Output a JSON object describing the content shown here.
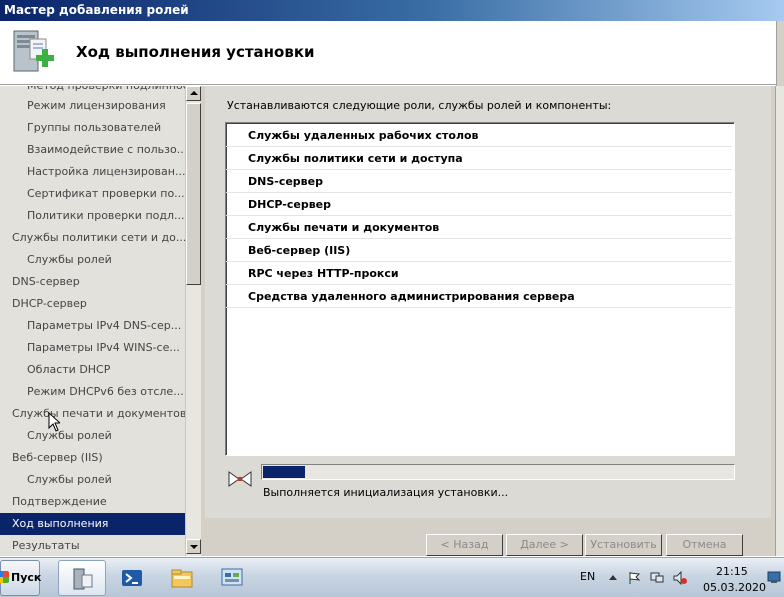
{
  "window": {
    "title": "Мастер добавления ролей"
  },
  "header": {
    "title": "Ход выполнения установки",
    "icon": "server-roles-add-icon"
  },
  "nav": {
    "items": [
      {
        "label": "Метод проверки подлинности",
        "level": 2
      },
      {
        "label": "Режим лицензирования",
        "level": 2
      },
      {
        "label": "Группы пользователей",
        "level": 2
      },
      {
        "label": "Взаимодействие с пользо...",
        "level": 2
      },
      {
        "label": "Настройка лицензирован...",
        "level": 2
      },
      {
        "label": "Сертификат проверки по...",
        "level": 2
      },
      {
        "label": "Политики проверки подл...",
        "level": 2
      },
      {
        "label": "Службы политики сети и до...",
        "level": 1
      },
      {
        "label": "Службы ролей",
        "level": 2
      },
      {
        "label": "DNS-сервер",
        "level": 1
      },
      {
        "label": "DHCP-сервер",
        "level": 1
      },
      {
        "label": "Параметры IPv4 DNS-сер...",
        "level": 2
      },
      {
        "label": "Параметры IPv4 WINS-се...",
        "level": 2
      },
      {
        "label": "Области DHCP",
        "level": 2
      },
      {
        "label": "Режим DHCPv6 без отсле...",
        "level": 2
      },
      {
        "label": "Службы печати и документов",
        "level": 1
      },
      {
        "label": "Службы ролей",
        "level": 2
      },
      {
        "label": "Веб-сервер (IIS)",
        "level": 1
      },
      {
        "label": "Службы ролей",
        "level": 2
      },
      {
        "label": "Подтверждение",
        "level": 1
      },
      {
        "label": "Ход выполнения",
        "level": 1,
        "active": true
      },
      {
        "label": "Результаты",
        "level": 1
      }
    ]
  },
  "main": {
    "intro": "Устанавливаются следующие роли, службы ролей и компоненты:",
    "components": [
      "Службы удаленных рабочих столов",
      "Службы политики сети и доступа",
      "DNS-сервер",
      "DHCP-сервер",
      "Службы печати и документов",
      "Веб-сервер (IIS)",
      "RPC через HTTP-прокси",
      "Средства удаленного администрирования сервера"
    ],
    "progress_fraction": 0.09,
    "status": "Выполняется инициализация установки..."
  },
  "buttons": {
    "back": "< Назад",
    "next": "Далее >",
    "install": "Установить",
    "cancel": "Отмена"
  },
  "taskbar": {
    "start": "Пуск",
    "apps": [
      "server-manager-icon",
      "powershell-icon",
      "explorer-folder-icon",
      "control-panel-icon"
    ],
    "language": "EN",
    "time": "21:15",
    "date": "05.03.2020"
  },
  "colors": {
    "selection": "#0a246a",
    "title_gradient_start": "#0a246a",
    "accent_green": "#3cb043"
  }
}
